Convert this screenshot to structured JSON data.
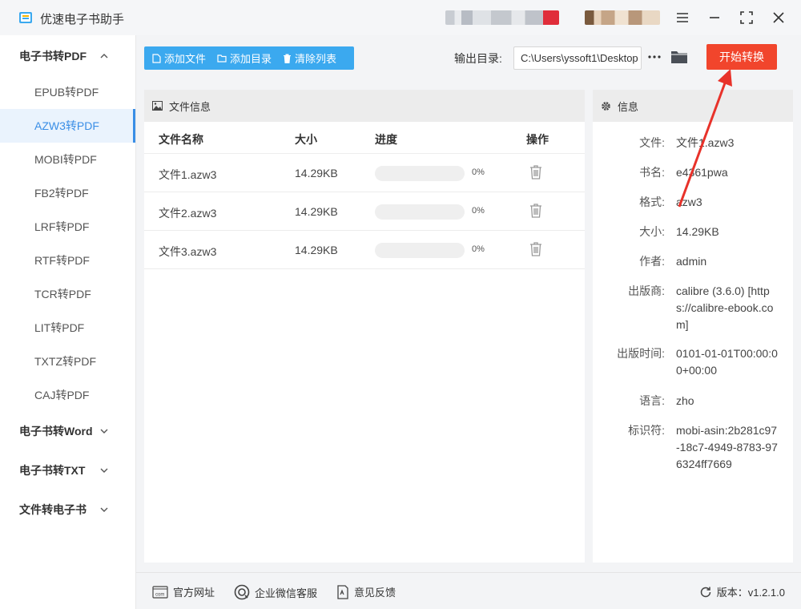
{
  "app": {
    "title": "优速电子书助手"
  },
  "sidebar": {
    "groups": [
      {
        "label": "电子书转PDF",
        "expanded": true
      },
      {
        "label": "电子书转Word"
      },
      {
        "label": "电子书转TXT"
      },
      {
        "label": "文件转电子书"
      }
    ],
    "items": [
      {
        "label": "EPUB转PDF"
      },
      {
        "label": "AZW3转PDF",
        "active": true
      },
      {
        "label": "MOBI转PDF"
      },
      {
        "label": "FB2转PDF"
      },
      {
        "label": "LRF转PDF"
      },
      {
        "label": "RTF转PDF"
      },
      {
        "label": "TCR转PDF"
      },
      {
        "label": "LIT转PDF"
      },
      {
        "label": "TXTZ转PDF"
      },
      {
        "label": "CAJ转PDF"
      }
    ]
  },
  "toolbar": {
    "add_file": "添加文件",
    "add_dir": "添加目录",
    "clear_list": "清除列表"
  },
  "output": {
    "label": "输出目录:",
    "path": "C:\\Users\\yssoft1\\Desktop"
  },
  "start_button": "开始转换",
  "file_panel": {
    "title": "文件信息",
    "columns": [
      "文件名称",
      "大小",
      "进度",
      "操作"
    ],
    "rows": [
      {
        "name": "文件1.azw3",
        "size": "14.29KB",
        "progress": "0%"
      },
      {
        "name": "文件2.azw3",
        "size": "14.29KB",
        "progress": "0%"
      },
      {
        "name": "文件3.azw3",
        "size": "14.29KB",
        "progress": "0%"
      }
    ]
  },
  "info_panel": {
    "title": "信息",
    "fields": [
      {
        "key": "文件:",
        "value": "文件1.azw3"
      },
      {
        "key": "书名:",
        "value": "e4361pwa"
      },
      {
        "key": "格式:",
        "value": "azw3"
      },
      {
        "key": "大小:",
        "value": "14.29KB"
      },
      {
        "key": "作者:",
        "value": "admin"
      },
      {
        "key": "出版商:",
        "value": "calibre (3.6.0) [https://calibre-ebook.com]"
      },
      {
        "key": "出版时间:",
        "value": "0101-01-01T00:00:00+00:00"
      },
      {
        "key": "语言:",
        "value": "zho"
      },
      {
        "key": "标识符:",
        "value": "mobi-asin:2b281c97-18c7-4949-8783-976324ff7669"
      }
    ]
  },
  "footer": {
    "website": "官方网址",
    "wechat": "企业微信客服",
    "feedback": "意见反馈",
    "version": "版本：v1.2.1.0"
  },
  "colors": {
    "accent": "#3ba9ef",
    "start": "#f1452c",
    "active_item": "#3a8ee6",
    "arrow": "#e8322a"
  },
  "icons": [
    "app-logo-icon",
    "menu-icon",
    "minimize-icon",
    "maximize-icon",
    "close-icon",
    "chevron-up-icon",
    "chevron-down-icon",
    "file-icon",
    "folder-icon",
    "trash-icon",
    "image-icon",
    "gear-icon",
    "web-icon",
    "chat-icon",
    "feedback-icon",
    "refresh-icon"
  ]
}
